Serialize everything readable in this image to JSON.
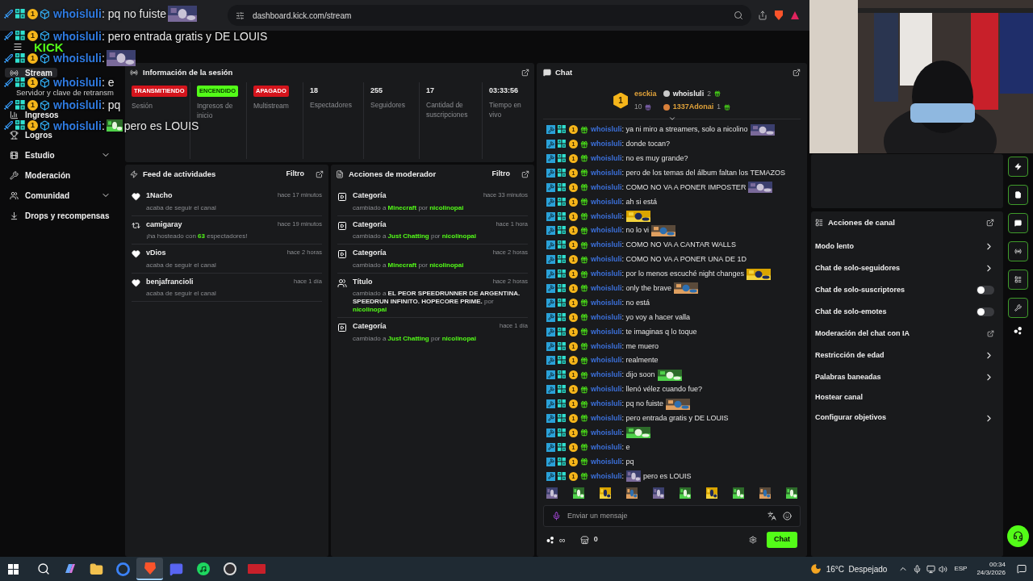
{
  "browser": {
    "url": "dashboard.kick.com/stream"
  },
  "overlay_chat": {
    "messages": [
      {
        "tier": "1",
        "user": "whoisluli",
        "text": ": pq no fuiste",
        "kind": "emote_after"
      },
      {
        "tier": "1",
        "user": "whoisluli",
        "text": ": pero entrada gratis y DE LOUIS",
        "kind": "text"
      },
      {
        "tier": "1",
        "user": "whoisluli",
        "text": ":",
        "kind": "emote_after"
      },
      {
        "tier": "1",
        "user": "whoisluli",
        "text": ": e",
        "kind": "text"
      },
      {
        "tier": "1",
        "user": "whoisluli",
        "text": ": pq",
        "kind": "text"
      },
      {
        "tier": "1",
        "user": "whoisluli",
        "text": ":",
        "after": "pero es LOUIS",
        "kind": "emote_between"
      }
    ]
  },
  "logo": "KICK",
  "sidebar": {
    "items": [
      {
        "kind": "stream",
        "label": "Stream",
        "selected": true,
        "expandable": false
      },
      {
        "kind": "sub",
        "label": "Servidor y clave de retransm",
        "selected": false,
        "expandable": false
      },
      {
        "kind": "chart",
        "label": "Ingresos",
        "selected": false,
        "expandable": false
      },
      {
        "kind": "trophy",
        "label": "Logros",
        "selected": false,
        "expandable": false
      },
      {
        "kind": "film",
        "label": "Estudio",
        "selected": false,
        "expandable": true
      },
      {
        "kind": "wrench",
        "label": "Moderación",
        "selected": false,
        "expandable": false
      },
      {
        "kind": "users",
        "label": "Comunidad",
        "selected": false,
        "expandable": true
      },
      {
        "kind": "drops",
        "label": "Drops y recompensas",
        "selected": false,
        "expandable": false
      }
    ]
  },
  "session": {
    "title": "Información de la sesión",
    "stats": [
      {
        "kind": "badge",
        "value": "TRANSMITIENDO",
        "color": "#d4141c",
        "label": "Sesión"
      },
      {
        "kind": "badge",
        "value": "ENCENDIDO",
        "color": "#53fc18",
        "label": "Ingresos de inicio"
      },
      {
        "kind": "badge",
        "value": "APAGADO",
        "color": "#d4141c",
        "label": "Multistream"
      },
      {
        "kind": "number",
        "value": "18",
        "label": "Espectadores"
      },
      {
        "kind": "number",
        "value": "255",
        "label": "Seguidores"
      },
      {
        "kind": "number",
        "value": "17",
        "label": "Cantidad de suscripciones"
      },
      {
        "kind": "number",
        "value": "03:33:56",
        "label": "Tiempo en vivo"
      }
    ]
  },
  "activity_feed": {
    "title": "Feed de actividades",
    "filter": "Filtro",
    "items": [
      {
        "kind": "follow",
        "name": "1Nacho",
        "time": "hace 17 minutos",
        "parts": [
          {
            "text": "acaba de seguir el canal",
            "kind": "text"
          }
        ]
      },
      {
        "kind": "host",
        "name": "camigaray",
        "time": "hace 19 minutos",
        "parts": [
          {
            "text": "¡ha hosteado con ",
            "kind": "text"
          },
          {
            "text": "63",
            "kind": "link"
          },
          {
            "text": " espectadores!",
            "kind": "text"
          }
        ]
      },
      {
        "kind": "follow",
        "name": "vDios",
        "time": "hace 2 horas",
        "parts": [
          {
            "text": "acaba de seguir el canal",
            "kind": "text"
          }
        ]
      },
      {
        "kind": "follow",
        "name": "benjafrancioli",
        "time": "hace 1 día",
        "parts": [
          {
            "text": "acaba de seguir el canal",
            "kind": "text"
          }
        ]
      }
    ]
  },
  "moderator_actions": {
    "title": "Acciones de moderador",
    "filter": "Filtro",
    "items": [
      {
        "kind": "category",
        "label": "Categoría",
        "time": "hace 33 minutos",
        "parts": [
          {
            "text": "cambiado a ",
            "kind": "text"
          },
          {
            "text": "Minecraft",
            "kind": "link"
          },
          {
            "text": " por ",
            "kind": "text"
          },
          {
            "text": "nicolinopai",
            "kind": "link"
          }
        ]
      },
      {
        "kind": "category",
        "label": "Categoría",
        "time": "hace 1 hora",
        "parts": [
          {
            "text": "cambiado a ",
            "kind": "text"
          },
          {
            "text": "Just Chatting",
            "kind": "link"
          },
          {
            "text": " por ",
            "kind": "text"
          },
          {
            "text": "nicolinopai",
            "kind": "link"
          }
        ]
      },
      {
        "kind": "category",
        "label": "Categoría",
        "time": "hace 2 horas",
        "parts": [
          {
            "text": "cambiado a ",
            "kind": "text"
          },
          {
            "text": "Minecraft",
            "kind": "link"
          },
          {
            "text": " por ",
            "kind": "text"
          },
          {
            "text": "nicolinopai",
            "kind": "link"
          }
        ]
      },
      {
        "kind": "title",
        "label": "Título",
        "time": "hace 2 horas",
        "parts": [
          {
            "text": "cambiado a ",
            "kind": "text"
          },
          {
            "text": "EL PEOR SPEEDRUNNER DE ARGENTINA. SPEEDRUN INFINITO. HOPECORE PRIME.",
            "kind": "title"
          },
          {
            "text": " por ",
            "kind": "text"
          },
          {
            "text": "nicolinopai",
            "kind": "link"
          }
        ]
      },
      {
        "kind": "category",
        "label": "Categoría",
        "time": "hace 1 día",
        "parts": [
          {
            "text": "cambiado a ",
            "kind": "text"
          },
          {
            "text": "Just Chatting",
            "kind": "link"
          },
          {
            "text": " por ",
            "kind": "text"
          },
          {
            "text": "nicolinopai",
            "kind": "link"
          }
        ]
      }
    ]
  },
  "chat": {
    "title": "Chat",
    "leaderboard": {
      "top": {
        "rank": "1",
        "name": "esckia",
        "count": "10"
      },
      "others": [
        {
          "name": "whoisluli",
          "count": "2",
          "kind": "silver"
        },
        {
          "name": "1337Adonai",
          "count": "1",
          "kind": "bronze"
        }
      ]
    },
    "messages": [
      {
        "tier": "1",
        "user": "whoisluli",
        "text": ": ya ni miro a streamers, solo a nicolino",
        "kind": "emote_after"
      },
      {
        "tier": "1",
        "user": "whoisluli",
        "text": ": donde tocan?",
        "kind": "text"
      },
      {
        "tier": "1",
        "user": "whoisluli",
        "text": ": no es muy grande?",
        "kind": "text"
      },
      {
        "tier": "1",
        "user": "whoisluli",
        "text": ": pero de los temas del álbum faltan los TEMAZOS",
        "kind": "text"
      },
      {
        "tier": "1",
        "user": "whoisluli",
        "text": ": COMO NO VA A PONER IMPOSTER",
        "kind": "emote_after"
      },
      {
        "tier": "1",
        "user": "whoisluli",
        "text": ": ah si está",
        "kind": "text"
      },
      {
        "tier": "1",
        "user": "whoisluli",
        "text": ":",
        "kind": "emote_after"
      },
      {
        "tier": "1",
        "user": "whoisluli",
        "text": ": no lo vi",
        "kind": "emote_after"
      },
      {
        "tier": "1",
        "user": "whoisluli",
        "text": ": COMO NO VA A CANTAR WALLS",
        "kind": "text"
      },
      {
        "tier": "1",
        "user": "whoisluli",
        "text": ": COMO NO VA A PONER UNA DE 1D",
        "kind": "text"
      },
      {
        "tier": "1",
        "user": "whoisluli",
        "text": ": por lo menos escuché night changes",
        "kind": "emote_after"
      },
      {
        "tier": "1",
        "user": "whoisluli",
        "text": ": only the brave",
        "kind": "emote_after"
      },
      {
        "tier": "1",
        "user": "whoisluli",
        "text": ": no está",
        "kind": "text"
      },
      {
        "tier": "1",
        "user": "whoisluli",
        "text": ": yo voy a hacer valla",
        "kind": "text"
      },
      {
        "tier": "1",
        "user": "whoisluli",
        "text": ": te imaginas q lo toque",
        "kind": "text"
      },
      {
        "tier": "1",
        "user": "whoisluli",
        "text": ": me muero",
        "kind": "text"
      },
      {
        "tier": "1",
        "user": "whoisluli",
        "text": ": realmente",
        "kind": "text"
      },
      {
        "tier": "1",
        "user": "whoisluli",
        "text": ": dijo soon",
        "kind": "emote_after"
      },
      {
        "tier": "1",
        "user": "whoisluli",
        "text": ": llenó vélez cuando fue?",
        "kind": "text"
      },
      {
        "tier": "1",
        "user": "whoisluli",
        "text": ": pq no fuiste",
        "kind": "emote_after"
      },
      {
        "tier": "1",
        "user": "whoisluli",
        "text": ": pero entrada gratis y DE LOUIS",
        "kind": "text"
      },
      {
        "tier": "1",
        "user": "whoisluli",
        "text": ":",
        "kind": "emote_after"
      },
      {
        "tier": "1",
        "user": "whoisluli",
        "text": ": e",
        "kind": "text"
      },
      {
        "tier": "1",
        "user": "whoisluli",
        "text": ": pq",
        "kind": "text"
      },
      {
        "tier": "1",
        "user": "whoisluli",
        "text": ":",
        "after": "pero es LOUIS",
        "kind": "emote_between"
      }
    ],
    "input": {
      "placeholder": "Enviar un mensaje"
    },
    "points": "∞",
    "store_count": "0",
    "send": "Chat"
  },
  "channel_actions": {
    "title": "Acciones de canal",
    "items": [
      {
        "kind": "arrow",
        "label": "Modo lento"
      },
      {
        "kind": "arrow",
        "label": "Chat de solo-seguidores"
      },
      {
        "kind": "toggle",
        "label": "Chat de solo-suscriptores",
        "on": false
      },
      {
        "kind": "toggle",
        "label": "Chat de solo-emotes",
        "on": false
      },
      {
        "kind": "external",
        "label": "Moderación del chat con IA"
      },
      {
        "kind": "arrow",
        "label": "Restricción de edad"
      },
      {
        "kind": "arrow",
        "label": "Palabras baneadas"
      },
      {
        "kind": "plain",
        "label": "Hostear canal"
      },
      {
        "kind": "arrow",
        "label": "Configurar objetivos"
      }
    ]
  },
  "taskbar": {
    "apps": [
      {
        "kind": "search",
        "selected": false
      },
      {
        "kind": "copilot",
        "selected": false
      },
      {
        "kind": "files",
        "selected": false
      },
      {
        "kind": "browser",
        "selected": false
      },
      {
        "kind": "brave",
        "selected": true
      },
      {
        "kind": "discord",
        "selected": false
      },
      {
        "kind": "spotify",
        "selected": false
      },
      {
        "kind": "obs",
        "selected": false
      },
      {
        "kind": "mixer",
        "selected": false
      }
    ],
    "weather": "16°C  Despejado",
    "language": "ESP",
    "time": "00:34",
    "date": "24/3/2026"
  }
}
